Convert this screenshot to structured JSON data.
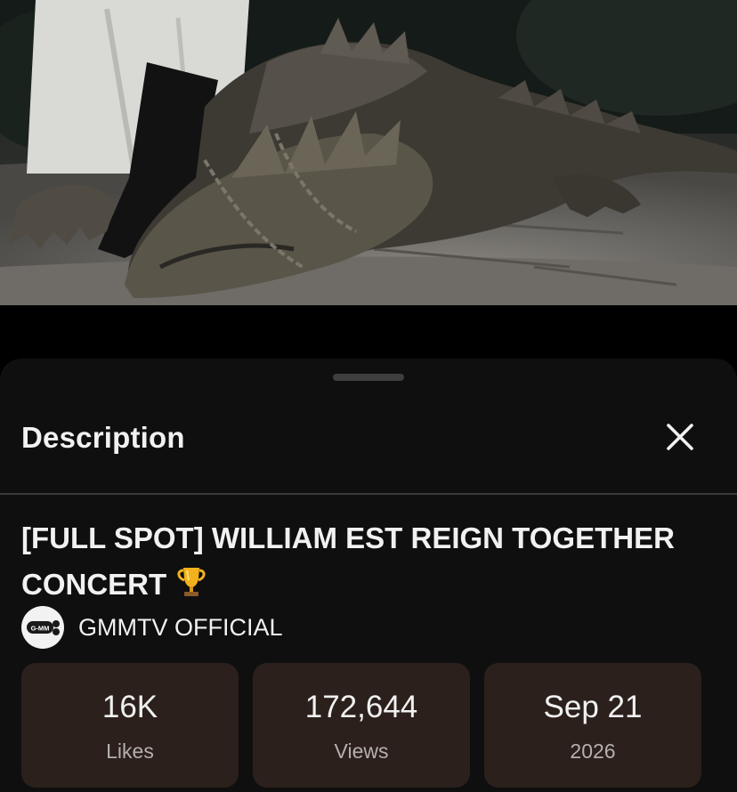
{
  "video": {
    "thumbnail_icon": "dragon-scene-video-frame"
  },
  "sheet": {
    "title": "Description",
    "close_icon": "close-icon"
  },
  "details": {
    "title": "[FULL SPOT] WILLIAM EST REIGN TOGETHER CONCERT",
    "title_emoji_icon": "trophy-icon",
    "channel": {
      "name": "GMMTV OFFICIAL",
      "avatar_text": "G-MM"
    },
    "stats": [
      {
        "value": "16K",
        "label": "Likes"
      },
      {
        "value": "172,644",
        "label": "Views"
      },
      {
        "value": "Sep 21",
        "label": "2026"
      }
    ]
  },
  "colors": {
    "sheet_background": "#0f0f0f",
    "card_background": "#2b201c",
    "text_primary": "#f1f1f1",
    "text_secondary": "#b5b0ad"
  }
}
